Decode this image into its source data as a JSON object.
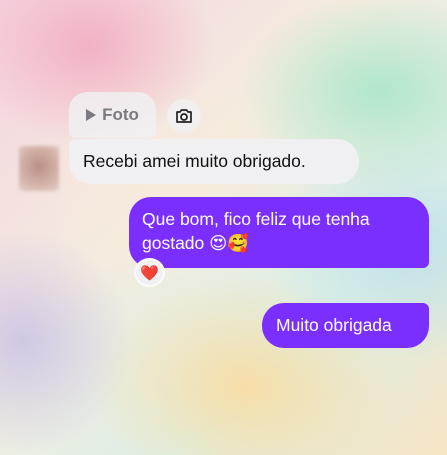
{
  "reply_preview": {
    "label": "Foto"
  },
  "icons": {
    "play": "play-icon",
    "camera": "camera-icon",
    "avatar": "blurred-avatar"
  },
  "messages": [
    {
      "direction": "incoming",
      "text": "Recebi amei muito obrigado."
    },
    {
      "direction": "outgoing",
      "text": "Que bom, fico feliz que tenha gostado 😍🥰",
      "reaction": "❤️"
    },
    {
      "direction": "outgoing",
      "text": "Muito obrigada"
    }
  ],
  "colors": {
    "outgoing_bubble": "#7b2fff",
    "incoming_bubble": "#f0f0f2",
    "reaction_heart": "#e0245e"
  }
}
